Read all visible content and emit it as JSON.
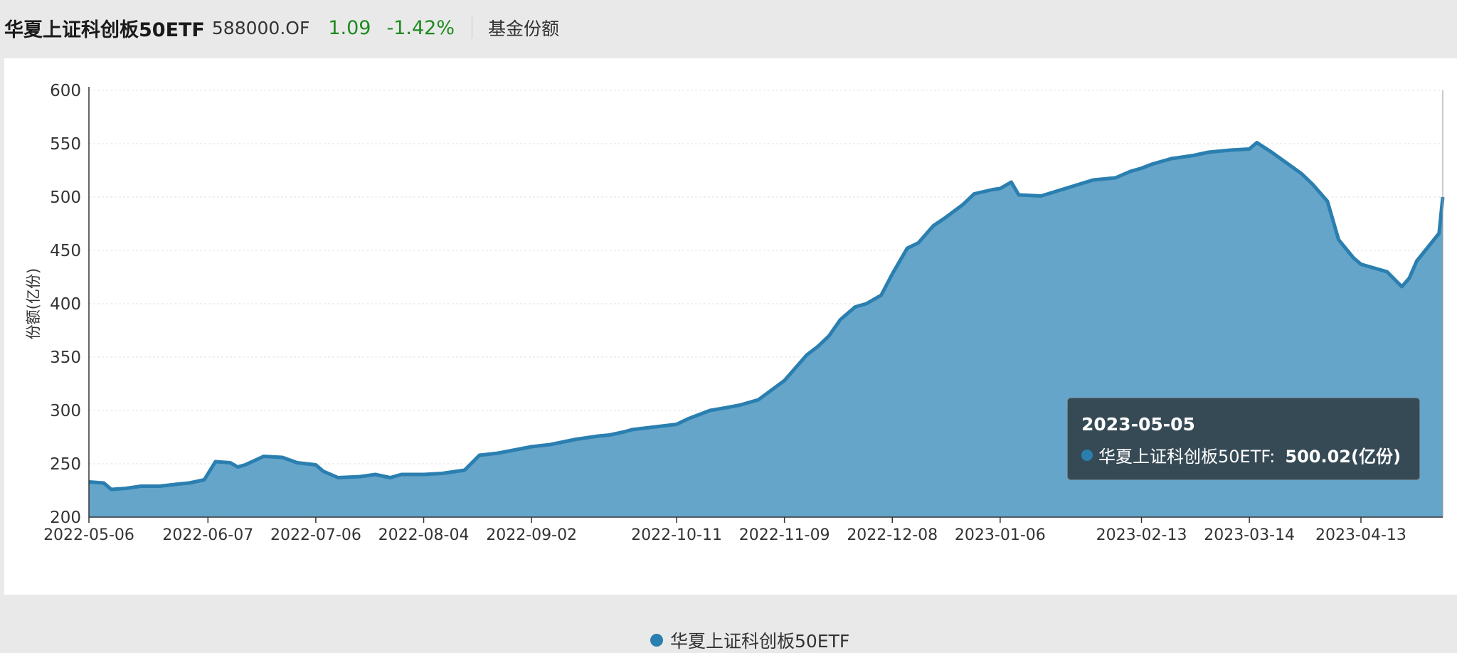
{
  "header": {
    "fund_name": "华夏上证科创板50ETF",
    "fund_code": "588000.OF",
    "nav": "1.09",
    "change": "-1.42%",
    "metric": "基金份额"
  },
  "tooltip": {
    "date": "2023-05-05",
    "series_label": "华夏上证科创板50ETF:",
    "value_label": "500.02(亿份)"
  },
  "legend": {
    "label": "华夏上证科创板50ETF"
  },
  "colors": {
    "line": "#2a7fb0",
    "area": "#65a5c9",
    "gain": "#1f8a1f",
    "tooltip_bg": "#34454f"
  },
  "chart_data": {
    "type": "area",
    "ylabel": "份额(亿份)",
    "xlabel": "",
    "ylim": [
      200,
      600
    ],
    "yticks": [
      200,
      250,
      300,
      350,
      400,
      450,
      500,
      550,
      600
    ],
    "xticks": [
      "2022-05-06",
      "2022-06-07",
      "2022-07-06",
      "2022-08-04",
      "2022-09-02",
      "2022-10-11",
      "2022-11-09",
      "2022-12-08",
      "2023-01-06",
      "2023-02-13",
      "2023-03-14",
      "2023-04-13"
    ],
    "grid": true,
    "legend_position": "bottom-center",
    "series": [
      {
        "name": "华夏上证科创板50ETF",
        "points": [
          [
            "2022-05-06",
            233
          ],
          [
            "2022-05-10",
            232
          ],
          [
            "2022-05-12",
            226
          ],
          [
            "2022-05-16",
            227
          ],
          [
            "2022-05-20",
            229
          ],
          [
            "2022-05-25",
            229
          ],
          [
            "2022-05-30",
            231
          ],
          [
            "2022-06-02",
            232
          ],
          [
            "2022-06-06",
            235
          ],
          [
            "2022-06-09",
            252
          ],
          [
            "2022-06-13",
            251
          ],
          [
            "2022-06-15",
            247
          ],
          [
            "2022-06-17",
            249
          ],
          [
            "2022-06-22",
            257
          ],
          [
            "2022-06-27",
            256
          ],
          [
            "2022-07-01",
            251
          ],
          [
            "2022-07-06",
            249
          ],
          [
            "2022-07-08",
            243
          ],
          [
            "2022-07-12",
            237
          ],
          [
            "2022-07-18",
            238
          ],
          [
            "2022-07-22",
            240
          ],
          [
            "2022-07-26",
            237
          ],
          [
            "2022-07-29",
            240
          ],
          [
            "2022-08-04",
            240
          ],
          [
            "2022-08-09",
            241
          ],
          [
            "2022-08-15",
            244
          ],
          [
            "2022-08-19",
            258
          ],
          [
            "2022-08-24",
            260
          ],
          [
            "2022-08-30",
            264
          ],
          [
            "2022-09-02",
            266
          ],
          [
            "2022-09-07",
            268
          ],
          [
            "2022-09-14",
            273
          ],
          [
            "2022-09-20",
            276
          ],
          [
            "2022-09-23",
            277
          ],
          [
            "2022-09-27",
            280
          ],
          [
            "2022-09-29",
            282
          ],
          [
            "2022-10-11",
            287
          ],
          [
            "2022-10-14",
            292
          ],
          [
            "2022-10-20",
            300
          ],
          [
            "2022-10-25",
            303
          ],
          [
            "2022-10-28",
            305
          ],
          [
            "2022-11-02",
            310
          ],
          [
            "2022-11-09",
            328
          ],
          [
            "2022-11-15",
            352
          ],
          [
            "2022-11-18",
            360
          ],
          [
            "2022-11-21",
            370
          ],
          [
            "2022-11-24",
            385
          ],
          [
            "2022-11-28",
            397
          ],
          [
            "2022-12-01",
            400
          ],
          [
            "2022-12-05",
            408
          ],
          [
            "2022-12-08",
            428
          ],
          [
            "2022-12-12",
            452
          ],
          [
            "2022-12-15",
            457
          ],
          [
            "2022-12-19",
            473
          ],
          [
            "2022-12-22",
            480
          ],
          [
            "2022-12-27",
            493
          ],
          [
            "2022-12-30",
            503
          ],
          [
            "2023-01-04",
            507
          ],
          [
            "2023-01-06",
            508
          ],
          [
            "2023-01-09",
            514
          ],
          [
            "2023-01-11",
            502
          ],
          [
            "2023-01-17",
            501
          ],
          [
            "2023-01-31",
            516
          ],
          [
            "2023-02-06",
            518
          ],
          [
            "2023-02-10",
            524
          ],
          [
            "2023-02-13",
            527
          ],
          [
            "2023-02-16",
            531
          ],
          [
            "2023-02-21",
            536
          ],
          [
            "2023-02-27",
            539
          ],
          [
            "2023-03-03",
            542
          ],
          [
            "2023-03-09",
            544
          ],
          [
            "2023-03-14",
            545
          ],
          [
            "2023-03-16",
            551
          ],
          [
            "2023-03-20",
            542
          ],
          [
            "2023-03-24",
            532
          ],
          [
            "2023-03-28",
            522
          ],
          [
            "2023-03-31",
            512
          ],
          [
            "2023-04-04",
            496
          ],
          [
            "2023-04-07",
            460
          ],
          [
            "2023-04-11",
            443
          ],
          [
            "2023-04-13",
            437
          ],
          [
            "2023-04-17",
            433
          ],
          [
            "2023-04-20",
            430
          ],
          [
            "2023-04-24",
            416
          ],
          [
            "2023-04-26",
            424
          ],
          [
            "2023-04-28",
            440
          ],
          [
            "2023-05-04",
            466
          ],
          [
            "2023-05-05",
            500
          ]
        ]
      }
    ]
  }
}
